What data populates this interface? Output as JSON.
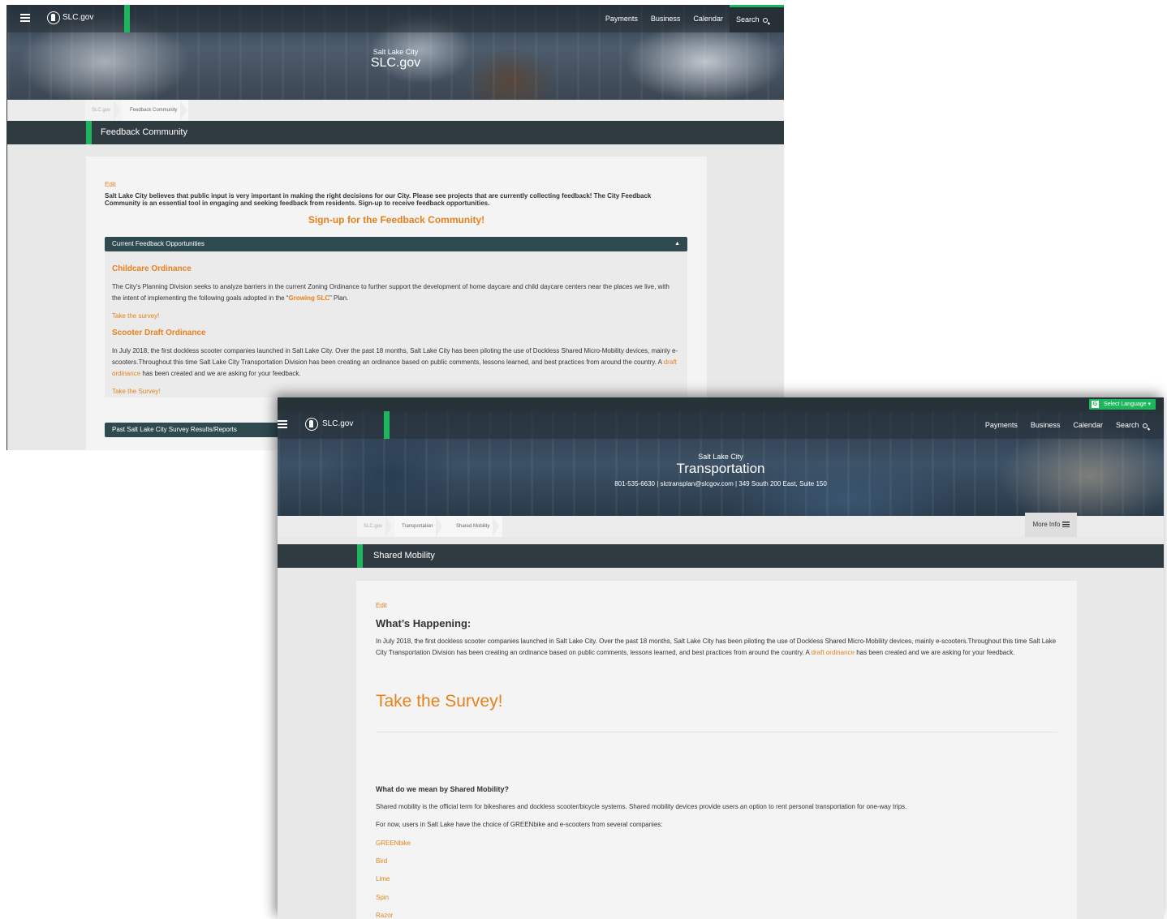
{
  "feedback_page": {
    "header": {
      "logo_text": "SLC.gov",
      "nav": [
        "Payments",
        "Business",
        "Calendar"
      ],
      "search_label": "Search",
      "site_subtitle": "Salt Lake City",
      "site_title": "SLC.gov"
    },
    "breadcrumb": [
      "SLC.gov",
      "Feedback Community"
    ],
    "page_title": "Feedback Community",
    "edit_label": "Edit",
    "intro": "Salt Lake City believes that public input is very important in making the right decisions for our City. Please see projects that are currently collecting feedback! The City Feedback Community is an essential tool in engaging and seeking feedback from residents. Sign-up to receive feedback opportunities.",
    "signup_link": "Sign-up for the Feedback Community!",
    "accordion_current": "Current Feedback Opportunities",
    "childcare": {
      "heading": "Childcare Ordinance",
      "text_before": "The City's Planning Division seeks to analyze barriers in the current Zoning Ordinance to further support the development of home daycare and child daycare centers near the places we live, with the intent of implementing the following goals adopted in the “",
      "link": "Growing SLC",
      "text_after": "” Plan.",
      "survey_link": "Take the survey!"
    },
    "scooter": {
      "heading": "Scooter Draft Ordinance",
      "text_before": "In July 2018, the first dockless scooter companies launched in Salt Lake City. Over the past 18 months, Salt Lake City has been piloting the use of Dockless Shared Micro-Mobility devices, mainly e-scooters.Throughout this time Salt Lake City Transportation Division has been creating an ordinance based on public comments, lessons learned, and best practices from around the country. A ",
      "link": "draft ordinance",
      "text_after": " has been created and we are asking for your feedback.",
      "survey_link": "Take the Survey!"
    },
    "accordion_past": "Past Salt Lake City Survey Results/Reports"
  },
  "mobility_page": {
    "language_button": "Select Language",
    "header": {
      "logo_text": "SLC.gov",
      "nav": [
        "Payments",
        "Business",
        "Calendar"
      ],
      "search_label": "Search",
      "site_subtitle": "Salt Lake City",
      "site_title": "Transportation",
      "contact": "801-535-6630 | slctransplan@slcgov.com | 349 South 200 East, Suite 150"
    },
    "breadcrumb": [
      "SLC.gov",
      "Transportation",
      "Shared Mobility"
    ],
    "more_info": "More Info",
    "page_title": "Shared Mobility",
    "edit_label": "Edit",
    "whats_happening": "What’s Happening:",
    "happening_before": "In July 2018, the first dockless scooter companies launched in Salt Lake City. Over the past 18 months, Salt Lake City has been piloting the use of Dockless Shared Micro-Mobility devices, mainly e-scooters.Throughout this time Salt Lake City Transportation Division has been creating an ordinance based on public comments, lessons learned, and best practices from around the country. A ",
    "happening_link": "draft ordinance",
    "happening_after": " has been created and we are asking for your feedback.",
    "survey_heading": "Take the Survey!",
    "what_mean_heading": "What do we mean by Shared Mobility?",
    "definition": "Shared mobility is the official term for bikeshares and dockless scooter/bicycle systems. Shared mobility devices provide users an option to rent personal transportation for one-way trips.",
    "choice_text": "For now, users in Salt Lake have the choice of GREENbike and e-scooters from several companies:",
    "companies": [
      "GREENbike",
      "Bird",
      "Lime",
      "Spin",
      "Razor"
    ]
  },
  "colors": {
    "accent_green": "#1cb65d",
    "link_orange": "#e7801c",
    "dark_bar": "#2f3b40"
  }
}
